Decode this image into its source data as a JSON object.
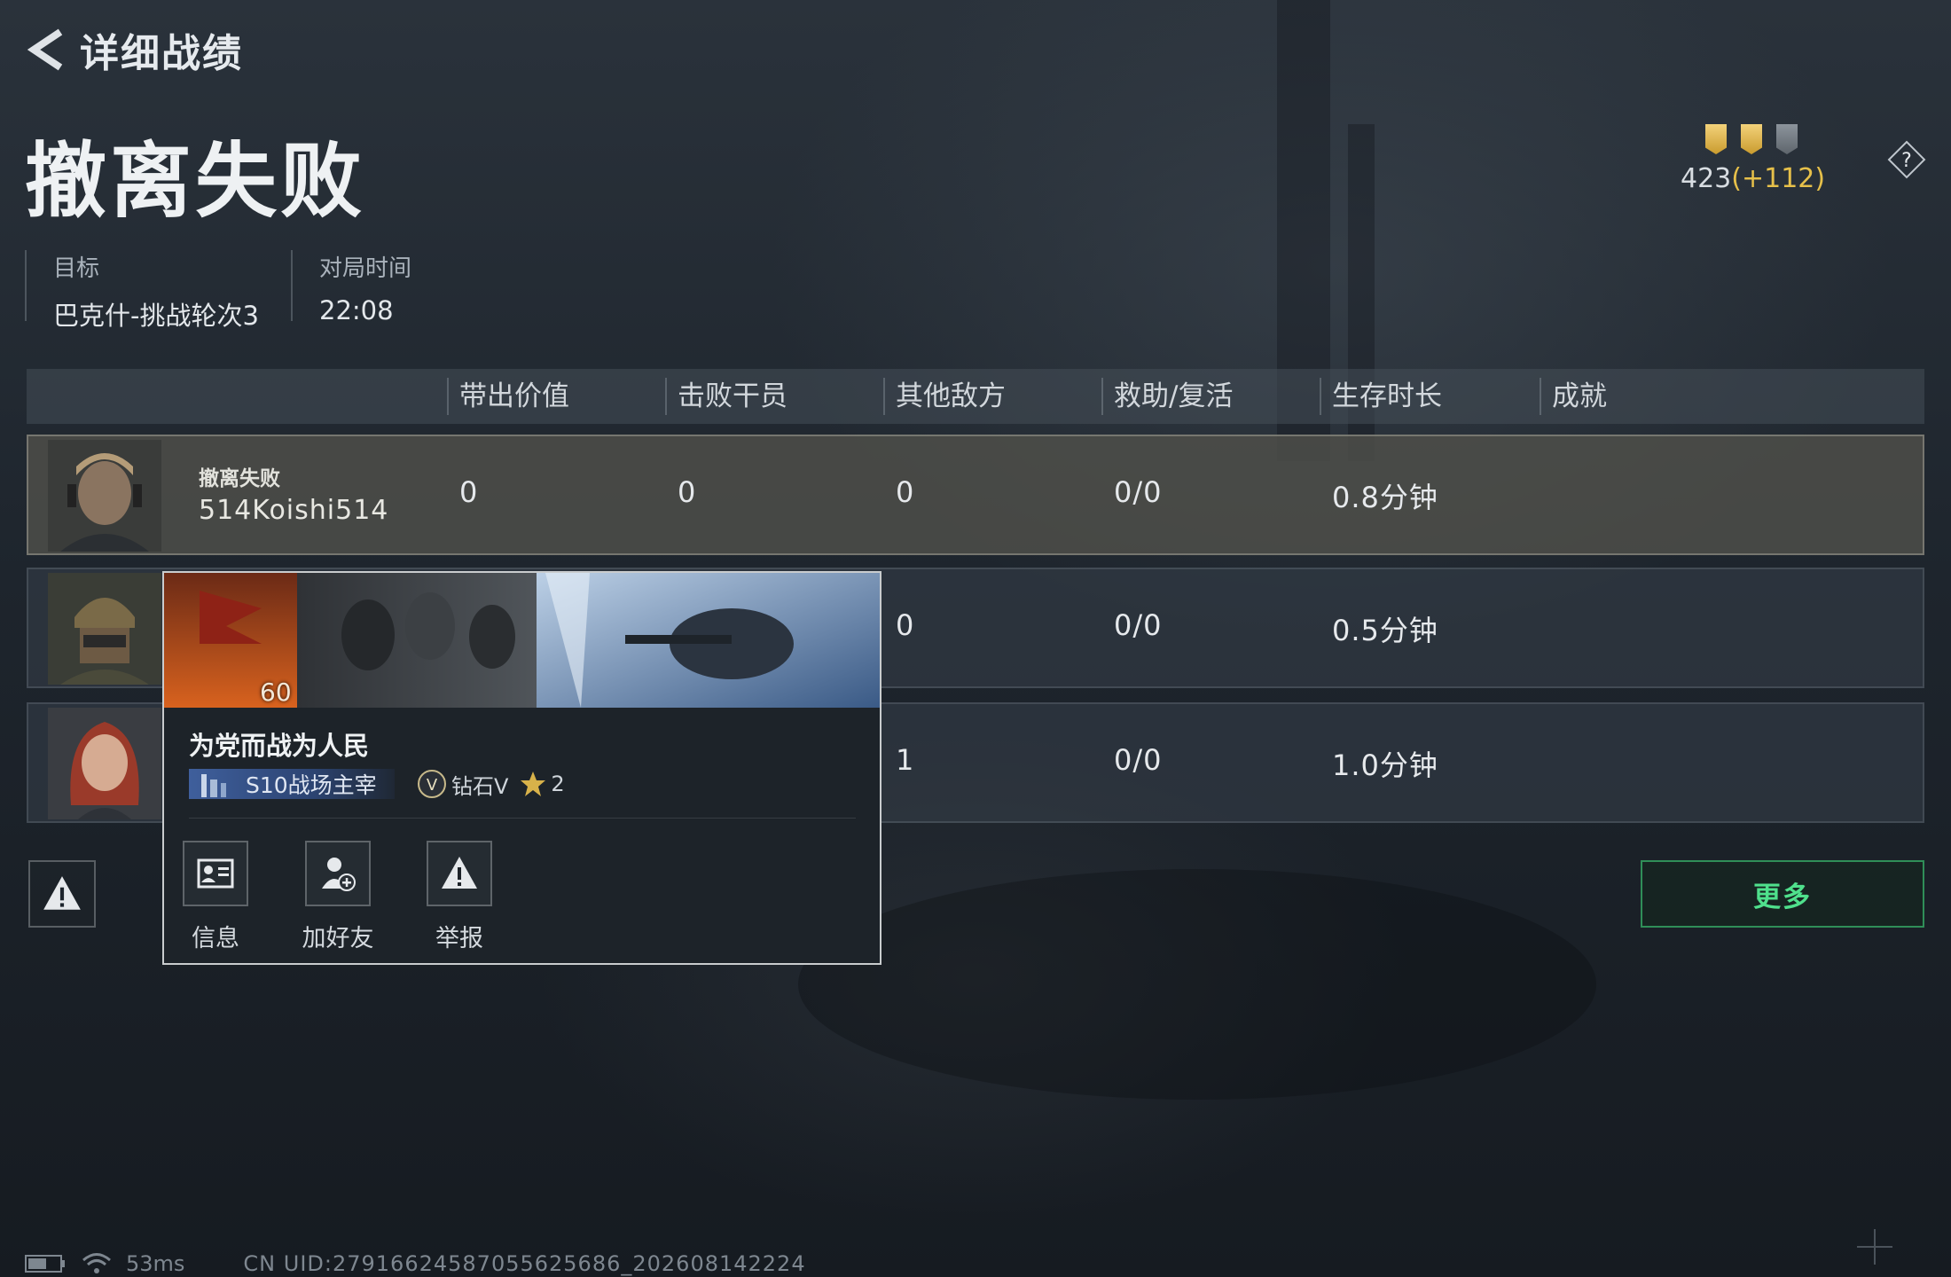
{
  "header": {
    "title": "详细战绩"
  },
  "result": {
    "title": "撤离失败"
  },
  "info": {
    "target_label": "目标",
    "target_value": "巴克什-挑战轮次3",
    "time_label": "对局时间",
    "time_value": "22:08"
  },
  "score": {
    "value": "423",
    "delta": "(+112)"
  },
  "medals": [
    "gold",
    "gold",
    "gray"
  ],
  "table": {
    "headers": [
      "带出价值",
      "击败干员",
      "其他敌方",
      "救助/复活",
      "生存时长",
      "成就"
    ],
    "rows": [
      {
        "status": "撤离失败",
        "name": "514Koishi514",
        "value": "0",
        "kills": "0",
        "others": "0",
        "assist": "0/0",
        "survival": "0.8分钟"
      },
      {
        "others": "0",
        "assist": "0/0",
        "survival": "0.5分钟"
      },
      {
        "others": "1",
        "assist": "0/0",
        "survival": "1.0分钟"
      }
    ]
  },
  "popup": {
    "level": "60",
    "name": "为党而战为人民",
    "season_badge": "S10战场主宰",
    "rank": "钻石V",
    "stars": "2",
    "actions": [
      {
        "label": "信息",
        "icon": "id-card-icon"
      },
      {
        "label": "加好友",
        "icon": "add-friend-icon"
      },
      {
        "label": "举报",
        "icon": "warning-icon"
      }
    ]
  },
  "more_button": "更多",
  "status_bar": {
    "ping": "53ms",
    "uid": "CN UID:27916624587055625686_202608142224"
  },
  "colors": {
    "accent_green": "#4fe08c",
    "gold": "#e6c04a"
  }
}
